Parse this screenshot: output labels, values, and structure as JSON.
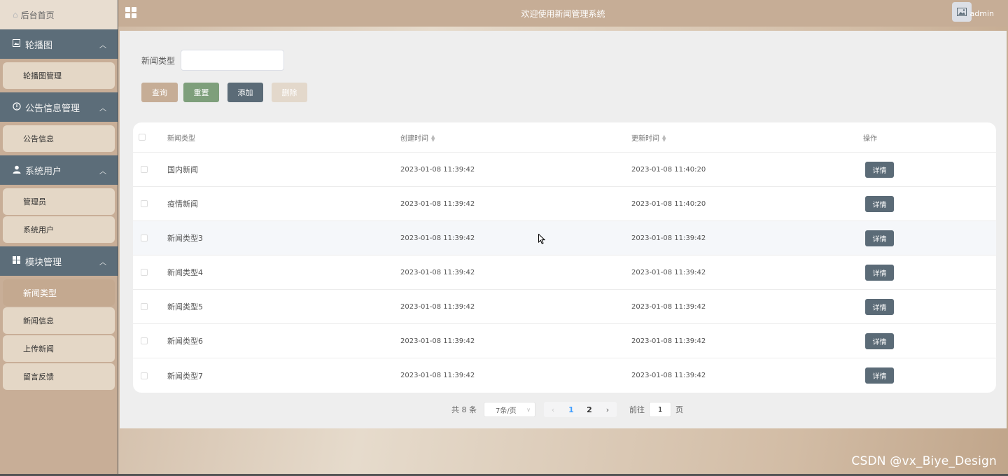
{
  "sidebar": {
    "home": "后台首页",
    "groups": [
      {
        "title": "轮播图",
        "icon": "image-icon",
        "items": [
          "轮播图管理"
        ]
      },
      {
        "title": "公告信息管理",
        "icon": "info-icon",
        "items": [
          "公告信息"
        ]
      },
      {
        "title": "系统用户",
        "icon": "user-icon",
        "items": [
          "管理员",
          "系统用户"
        ]
      },
      {
        "title": "模块管理",
        "icon": "grid-icon",
        "items": [
          "新闻类型",
          "新闻信息",
          "上传新闻",
          "留言反馈"
        ]
      }
    ],
    "active_item": "新闻类型"
  },
  "header": {
    "title": "欢迎使用新闻管理系统",
    "user": "admin"
  },
  "search": {
    "label": "新闻类型",
    "value": "",
    "placeholder": ""
  },
  "buttons": {
    "query": "查询",
    "reset": "重置",
    "add": "添加",
    "delete": "删除"
  },
  "table": {
    "columns": [
      "新闻类型",
      "创建时间",
      "更新时间",
      "操作"
    ],
    "rows": [
      {
        "type": "国内新闻",
        "created": "2023-01-08 11:39:42",
        "updated": "2023-01-08 11:40:20",
        "action": "详情"
      },
      {
        "type": "疫情新闻",
        "created": "2023-01-08 11:39:42",
        "updated": "2023-01-08 11:40:20",
        "action": "详情"
      },
      {
        "type": "新闻类型3",
        "created": "2023-01-08 11:39:42",
        "updated": "2023-01-08 11:39:42",
        "action": "详情"
      },
      {
        "type": "新闻类型4",
        "created": "2023-01-08 11:39:42",
        "updated": "2023-01-08 11:39:42",
        "action": "详情"
      },
      {
        "type": "新闻类型5",
        "created": "2023-01-08 11:39:42",
        "updated": "2023-01-08 11:39:42",
        "action": "详情"
      },
      {
        "type": "新闻类型6",
        "created": "2023-01-08 11:39:42",
        "updated": "2023-01-08 11:39:42",
        "action": "详情"
      },
      {
        "type": "新闻类型7",
        "created": "2023-01-08 11:39:42",
        "updated": "2023-01-08 11:39:42",
        "action": "详情"
      }
    ]
  },
  "pagination": {
    "total": "共 8 条",
    "page_size": "7条/页",
    "pages": [
      "1",
      "2"
    ],
    "current": "1",
    "goto_prefix": "前往",
    "goto_value": "1",
    "goto_suffix": "页"
  },
  "watermark": "CSDN @vx_Biye_Design",
  "colors": {
    "accent_tan": "#c6ad96",
    "slate": "#5b6b77",
    "green": "#7e9f7b",
    "current_page": "#409eff"
  }
}
